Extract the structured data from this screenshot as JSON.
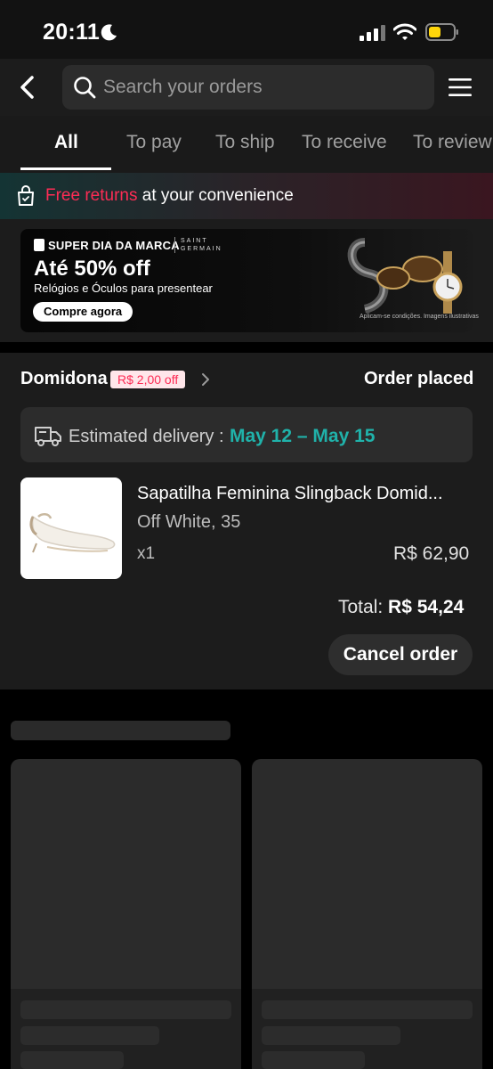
{
  "status_bar": {
    "time": "20:11"
  },
  "search": {
    "placeholder": "Search your orders"
  },
  "tabs": [
    {
      "label": "All"
    },
    {
      "label": "To pay"
    },
    {
      "label": "To ship"
    },
    {
      "label": "To receive"
    },
    {
      "label": "To review"
    }
  ],
  "promo": {
    "highlight": "Free returns",
    "rest": " at your convenience"
  },
  "banner": {
    "line1": "SUPER DIA DA MARCA",
    "brand": "SAINT GERMAIN",
    "headline": "Até 50% off",
    "subline": "Relógios e Óculos para presentear",
    "cta": "Compre agora",
    "disclaimer": "Aplicam-se condições. Imagens ilustrativas"
  },
  "order": {
    "shop": "Domidona",
    "discount_badge": "R$ 2,00 off",
    "status": "Order placed",
    "delivery_label": "Estimated delivery :",
    "delivery_date": "May 12 – May 15",
    "product_name": "Sapatilha Feminina Slingback Domid...",
    "variant": "Off White, 35",
    "quantity": "x1",
    "price": "R$ 62,90",
    "total_label": "Total:",
    "total_value": "R$ 54,24",
    "cancel_button": "Cancel order"
  },
  "colors": {
    "accent_red": "#fe2c55",
    "teal": "#20b2aa",
    "background": "#000000",
    "card": "#1c1c1c"
  }
}
